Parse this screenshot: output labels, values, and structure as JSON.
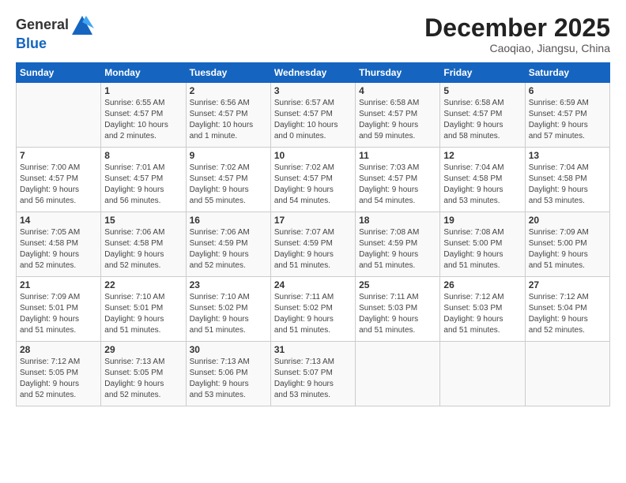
{
  "header": {
    "logo_general": "General",
    "logo_blue": "Blue",
    "month_title": "December 2025",
    "location": "Caoqiao, Jiangsu, China"
  },
  "days_of_week": [
    "Sunday",
    "Monday",
    "Tuesday",
    "Wednesday",
    "Thursday",
    "Friday",
    "Saturday"
  ],
  "weeks": [
    [
      {
        "day": "",
        "content": ""
      },
      {
        "day": "1",
        "content": "Sunrise: 6:55 AM\nSunset: 4:57 PM\nDaylight: 10 hours\nand 2 minutes."
      },
      {
        "day": "2",
        "content": "Sunrise: 6:56 AM\nSunset: 4:57 PM\nDaylight: 10 hours\nand 1 minute."
      },
      {
        "day": "3",
        "content": "Sunrise: 6:57 AM\nSunset: 4:57 PM\nDaylight: 10 hours\nand 0 minutes."
      },
      {
        "day": "4",
        "content": "Sunrise: 6:58 AM\nSunset: 4:57 PM\nDaylight: 9 hours\nand 59 minutes."
      },
      {
        "day": "5",
        "content": "Sunrise: 6:58 AM\nSunset: 4:57 PM\nDaylight: 9 hours\nand 58 minutes."
      },
      {
        "day": "6",
        "content": "Sunrise: 6:59 AM\nSunset: 4:57 PM\nDaylight: 9 hours\nand 57 minutes."
      }
    ],
    [
      {
        "day": "7",
        "content": "Sunrise: 7:00 AM\nSunset: 4:57 PM\nDaylight: 9 hours\nand 56 minutes."
      },
      {
        "day": "8",
        "content": "Sunrise: 7:01 AM\nSunset: 4:57 PM\nDaylight: 9 hours\nand 56 minutes."
      },
      {
        "day": "9",
        "content": "Sunrise: 7:02 AM\nSunset: 4:57 PM\nDaylight: 9 hours\nand 55 minutes."
      },
      {
        "day": "10",
        "content": "Sunrise: 7:02 AM\nSunset: 4:57 PM\nDaylight: 9 hours\nand 54 minutes."
      },
      {
        "day": "11",
        "content": "Sunrise: 7:03 AM\nSunset: 4:57 PM\nDaylight: 9 hours\nand 54 minutes."
      },
      {
        "day": "12",
        "content": "Sunrise: 7:04 AM\nSunset: 4:58 PM\nDaylight: 9 hours\nand 53 minutes."
      },
      {
        "day": "13",
        "content": "Sunrise: 7:04 AM\nSunset: 4:58 PM\nDaylight: 9 hours\nand 53 minutes."
      }
    ],
    [
      {
        "day": "14",
        "content": "Sunrise: 7:05 AM\nSunset: 4:58 PM\nDaylight: 9 hours\nand 52 minutes."
      },
      {
        "day": "15",
        "content": "Sunrise: 7:06 AM\nSunset: 4:58 PM\nDaylight: 9 hours\nand 52 minutes."
      },
      {
        "day": "16",
        "content": "Sunrise: 7:06 AM\nSunset: 4:59 PM\nDaylight: 9 hours\nand 52 minutes."
      },
      {
        "day": "17",
        "content": "Sunrise: 7:07 AM\nSunset: 4:59 PM\nDaylight: 9 hours\nand 51 minutes."
      },
      {
        "day": "18",
        "content": "Sunrise: 7:08 AM\nSunset: 4:59 PM\nDaylight: 9 hours\nand 51 minutes."
      },
      {
        "day": "19",
        "content": "Sunrise: 7:08 AM\nSunset: 5:00 PM\nDaylight: 9 hours\nand 51 minutes."
      },
      {
        "day": "20",
        "content": "Sunrise: 7:09 AM\nSunset: 5:00 PM\nDaylight: 9 hours\nand 51 minutes."
      }
    ],
    [
      {
        "day": "21",
        "content": "Sunrise: 7:09 AM\nSunset: 5:01 PM\nDaylight: 9 hours\nand 51 minutes."
      },
      {
        "day": "22",
        "content": "Sunrise: 7:10 AM\nSunset: 5:01 PM\nDaylight: 9 hours\nand 51 minutes."
      },
      {
        "day": "23",
        "content": "Sunrise: 7:10 AM\nSunset: 5:02 PM\nDaylight: 9 hours\nand 51 minutes."
      },
      {
        "day": "24",
        "content": "Sunrise: 7:11 AM\nSunset: 5:02 PM\nDaylight: 9 hours\nand 51 minutes."
      },
      {
        "day": "25",
        "content": "Sunrise: 7:11 AM\nSunset: 5:03 PM\nDaylight: 9 hours\nand 51 minutes."
      },
      {
        "day": "26",
        "content": "Sunrise: 7:12 AM\nSunset: 5:03 PM\nDaylight: 9 hours\nand 51 minutes."
      },
      {
        "day": "27",
        "content": "Sunrise: 7:12 AM\nSunset: 5:04 PM\nDaylight: 9 hours\nand 52 minutes."
      }
    ],
    [
      {
        "day": "28",
        "content": "Sunrise: 7:12 AM\nSunset: 5:05 PM\nDaylight: 9 hours\nand 52 minutes."
      },
      {
        "day": "29",
        "content": "Sunrise: 7:13 AM\nSunset: 5:05 PM\nDaylight: 9 hours\nand 52 minutes."
      },
      {
        "day": "30",
        "content": "Sunrise: 7:13 AM\nSunset: 5:06 PM\nDaylight: 9 hours\nand 53 minutes."
      },
      {
        "day": "31",
        "content": "Sunrise: 7:13 AM\nSunset: 5:07 PM\nDaylight: 9 hours\nand 53 minutes."
      },
      {
        "day": "",
        "content": ""
      },
      {
        "day": "",
        "content": ""
      },
      {
        "day": "",
        "content": ""
      }
    ]
  ]
}
